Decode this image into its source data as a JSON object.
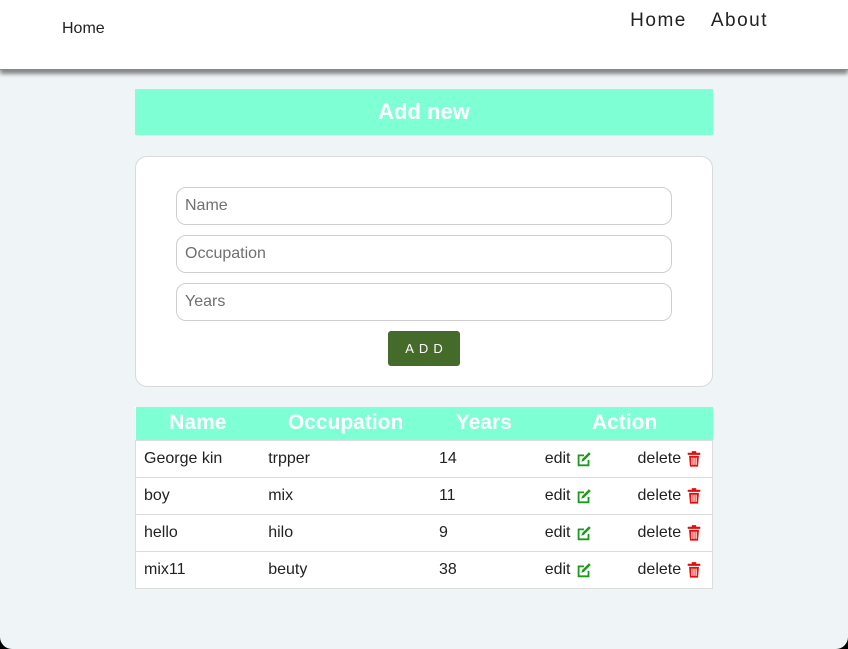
{
  "navbar": {
    "brand": "Home",
    "links": [
      "Home",
      "About"
    ]
  },
  "banner": {
    "title": "Add new"
  },
  "form": {
    "name_placeholder": "Name",
    "occupation_placeholder": "Occupation",
    "years_placeholder": "Years",
    "add_label": "ADD"
  },
  "table": {
    "headers": [
      "Name",
      "Occupation",
      "Years",
      "Action"
    ],
    "edit_label": "edit",
    "delete_label": "delete",
    "rows": [
      {
        "name": "George kin",
        "occupation": "trpper",
        "years": "14"
      },
      {
        "name": "boy",
        "occupation": "mix",
        "years": "11"
      },
      {
        "name": "hello",
        "occupation": "hilo",
        "years": "9"
      },
      {
        "name": "mix11",
        "occupation": "beuty",
        "years": "38"
      }
    ]
  },
  "icons": {
    "edit": "edit-icon",
    "delete": "trash-icon"
  },
  "colors": {
    "accent": "#7fffd4",
    "button": "#446b2a",
    "edit_icon": "#1a9a1a",
    "delete_icon": "#e01010"
  }
}
